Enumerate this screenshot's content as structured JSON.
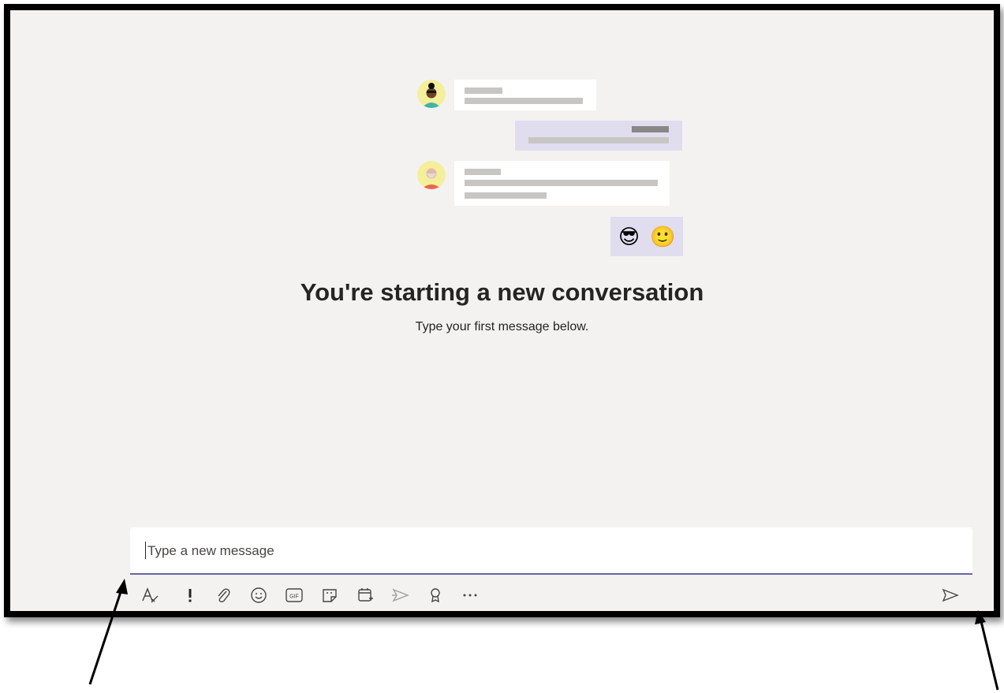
{
  "empty_state": {
    "title": "You're starting a new conversation",
    "subtitle": "Type your first message below.",
    "emoji_1": "😎",
    "emoji_2": "🙂"
  },
  "compose": {
    "placeholder": "Type a new message"
  },
  "toolbar": {
    "tools": [
      {
        "name": "format-icon"
      },
      {
        "name": "important-icon"
      },
      {
        "name": "attach-icon"
      },
      {
        "name": "emoji-icon"
      },
      {
        "name": "gif-icon",
        "label": "GIF"
      },
      {
        "name": "sticker-icon"
      },
      {
        "name": "schedule-meeting-icon"
      },
      {
        "name": "stream-icon"
      },
      {
        "name": "praise-icon"
      },
      {
        "name": "more-options-icon"
      }
    ],
    "send": {
      "name": "send-icon"
    }
  },
  "colors": {
    "background": "#f3f2f1",
    "accent": "#6264a7",
    "own_bubble": "#e0ddee",
    "frame": "#000000"
  }
}
